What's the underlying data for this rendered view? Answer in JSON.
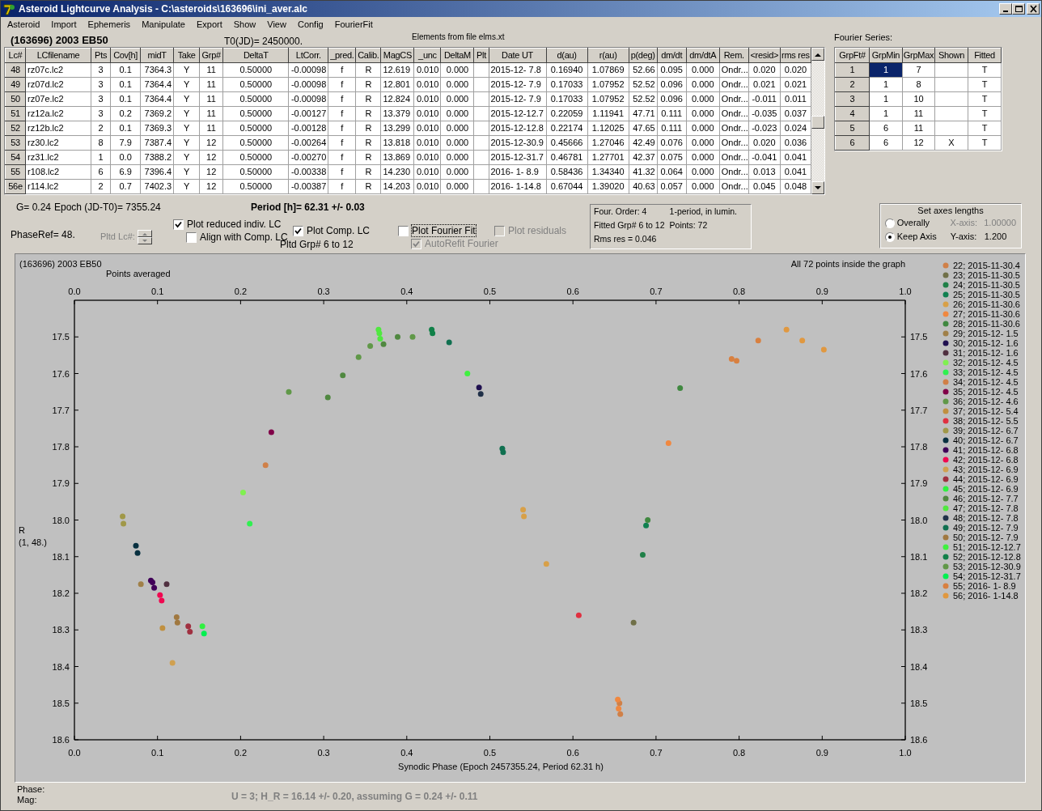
{
  "window": {
    "title": "Asteroid Lightcurve Analysis - C:\\asteroids\\163696\\ini_aver.alc"
  },
  "menu": [
    "Asteroid",
    "Import",
    "Ephemeris",
    "Manipulate",
    "Export",
    "Show",
    "View",
    "Config",
    "FourierFit"
  ],
  "header": {
    "object": "(163696) 2003 EB50",
    "t0": "T0(JD)= 2450000.",
    "elements": "Elements from file elms.xt"
  },
  "lc_table": {
    "columns": [
      "Lc#",
      "LCfilename",
      "Pts",
      "Cov[h]",
      "midT",
      "Take",
      "Grp#",
      "DeltaT",
      "LtCorr.",
      "_pred.",
      "Calib.",
      "MagCS",
      "_unc",
      "DeltaM",
      "Plt",
      "Date UT",
      "d(au)",
      "r(au)",
      "p(deg)",
      "dm/dt",
      "dm/dtA",
      "Rem.",
      "<resid>",
      "rms res"
    ],
    "rows": [
      {
        "cells": [
          "48",
          "rz07c.lc2",
          "3",
          "0.1",
          "7364.3",
          "Y",
          "11",
          "0.50000",
          "-0.00098",
          "f",
          "R",
          "12.619",
          "0.010",
          "0.000",
          null,
          "2015-12- 7.8",
          "0.16940",
          "1.07869",
          "52.66",
          "0.095",
          "0.000",
          "Ondr...",
          "0.020",
          "0.020"
        ]
      },
      {
        "cells": [
          "49",
          "rz07d.lc2",
          "3",
          "0.1",
          "7364.4",
          "Y",
          "11",
          "0.50000",
          "-0.00098",
          "f",
          "R",
          "12.801",
          "0.010",
          "0.000",
          null,
          "2015-12- 7.9",
          "0.17033",
          "1.07952",
          "52.52",
          "0.096",
          "0.000",
          "Ondr...",
          "0.021",
          "0.021"
        ]
      },
      {
        "cells": [
          "50",
          "rz07e.lc2",
          "3",
          "0.1",
          "7364.4",
          "Y",
          "11",
          "0.50000",
          "-0.00098",
          "f",
          "R",
          "12.824",
          "0.010",
          "0.000",
          null,
          "2015-12- 7.9",
          "0.17033",
          "1.07952",
          "52.52",
          "0.096",
          "0.000",
          "Ondr...",
          "-0.011",
          "0.011"
        ]
      },
      {
        "cells": [
          "51",
          "rz12a.lc2",
          "3",
          "0.2",
          "7369.2",
          "Y",
          "11",
          "0.50000",
          "-0.00127",
          "f",
          "R",
          "13.379",
          "0.010",
          "0.000",
          null,
          "2015-12-12.7",
          "0.22059",
          "1.11941",
          "47.71",
          "0.111",
          "0.000",
          "Ondr...",
          "-0.035",
          "0.037"
        ]
      },
      {
        "cells": [
          "52",
          "rz12b.lc2",
          "2",
          "0.1",
          "7369.3",
          "Y",
          "11",
          "0.50000",
          "-0.00128",
          "f",
          "R",
          "13.299",
          "0.010",
          "0.000",
          null,
          "2015-12-12.8",
          "0.22174",
          "1.12025",
          "47.65",
          "0.111",
          "0.000",
          "Ondr...",
          "-0.023",
          "0.024"
        ]
      },
      {
        "cells": [
          "53",
          "rz30.lc2",
          "8",
          "7.9",
          "7387.4",
          "Y",
          "12",
          "0.50000",
          "-0.00264",
          "f",
          "R",
          "13.818",
          "0.010",
          "0.000",
          null,
          "2015-12-30.9",
          "0.45666",
          "1.27046",
          "42.49",
          "0.076",
          "0.000",
          "Ondr...",
          "0.020",
          "0.036"
        ]
      },
      {
        "cells": [
          "54",
          "rz31.lc2",
          "1",
          "0.0",
          "7388.2",
          "Y",
          "12",
          "0.50000",
          "-0.00270",
          "f",
          "R",
          "13.869",
          "0.010",
          "0.000",
          null,
          "2015-12-31.7",
          "0.46781",
          "1.27701",
          "42.37",
          "0.075",
          "0.000",
          "Ondr...",
          "-0.041",
          "0.041"
        ]
      },
      {
        "cells": [
          "55",
          "r108.lc2",
          "6",
          "6.9",
          "7396.4",
          "Y",
          "12",
          "0.50000",
          "-0.00338",
          "f",
          "R",
          "14.230",
          "0.010",
          "0.000",
          null,
          "2016- 1- 8.9",
          "0.58436",
          "1.34340",
          "41.32",
          "0.064",
          "0.000",
          "Ondr...",
          "0.013",
          "0.041"
        ]
      },
      {
        "cells": [
          "56e",
          "r114.lc2",
          "2",
          "0.7",
          "7402.3",
          "Y",
          "12",
          "0.50000",
          "-0.00387",
          "f",
          "R",
          "14.203",
          "0.010",
          "0.000",
          null,
          "2016- 1-14.8",
          "0.67044",
          "1.39020",
          "40.63",
          "0.057",
          "0.000",
          "Ondr...",
          "0.045",
          "0.048"
        ]
      }
    ]
  },
  "fourier": {
    "title": "Fourier Series:",
    "columns": [
      "GrpFt#",
      "GrpMin",
      "GrpMax",
      "Shown",
      "Fitted"
    ],
    "rows": [
      {
        "cells": [
          "1",
          "1",
          "7",
          null,
          "T"
        ],
        "selected": true
      },
      {
        "cells": [
          "2",
          "1",
          "8",
          null,
          "T"
        ],
        "selected": false
      },
      {
        "cells": [
          "3",
          "1",
          "10",
          null,
          "T"
        ],
        "selected": false
      },
      {
        "cells": [
          "4",
          "1",
          "11",
          null,
          "T"
        ],
        "selected": false
      },
      {
        "cells": [
          "5",
          "6",
          "11",
          null,
          "T"
        ],
        "selected": false
      },
      {
        "cells": [
          "6",
          "6",
          "12",
          "X",
          "T"
        ],
        "selected": false
      }
    ]
  },
  "status": {
    "g": "G= 0.24",
    "epoch": "Epoch (JD-T0)= 7355.24",
    "period": "Period [h]= 62.31 +/- 0.03",
    "phase_ref": "PhaseRef= 48."
  },
  "pltd_lc": {
    "label": "Pltd Lc#:",
    "disabled": true
  },
  "option_groups": [
    {
      "options": [
        {
          "label": "Plot reduced indiv. LC",
          "checked": true,
          "disabled": false
        },
        {
          "label": "Align with Comp. LC",
          "checked": false,
          "disabled": false
        }
      ]
    },
    {
      "options": [
        {
          "label": "Plot Comp. LC",
          "checked": true,
          "disabled": false
        }
      ],
      "note": "Pltd Grp#  6  to  12"
    },
    {
      "options": [
        {
          "label": "Plot Fourier Fit",
          "checked": false,
          "disabled": false,
          "focused": true
        },
        {
          "label": "AutoRefit Fourier",
          "checked": true,
          "disabled": true
        }
      ]
    },
    {
      "options": [
        {
          "label": "Plot residuals",
          "checked": false,
          "disabled": true
        }
      ]
    }
  ],
  "fit_info": {
    "lines": [
      [
        "Four. Order:  4",
        "1-period, in lumin."
      ],
      [
        "Fitted Grp# 6 to 12",
        "Points: 72"
      ],
      [
        "Rms res     = 0.046"
      ]
    ]
  },
  "axes_box": {
    "title": "Set axes lengths",
    "options": [
      {
        "label": "Overally",
        "selected": false
      },
      {
        "label": "Keep Axis",
        "selected": true
      }
    ],
    "fields": [
      {
        "label": "X-axis:",
        "value": "1.00000",
        "disabled": true
      },
      {
        "label": "Y-axis:",
        "value": "1.200",
        "disabled": false
      }
    ]
  },
  "plot": {
    "title": "(163696) 2003 EB50",
    "subtitle": "Points averaged",
    "note": "All 72 points inside the graph",
    "y_note": "(1, 48.)",
    "chart_data": {
      "type": "scatter",
      "legend": "right",
      "xlabel": "Synodic Phase (Epoch 2457355.24, Period 62.31 h)",
      "ylabel": "R",
      "xlim": [
        0,
        1
      ],
      "ylim": [
        18.6,
        17.4
      ],
      "xticks": [
        {
          "value": 0,
          "label": "0.0"
        },
        {
          "value": 0.1,
          "label": "0.1"
        },
        {
          "value": 0.2,
          "label": "0.2"
        },
        {
          "value": 0.3,
          "label": "0.3"
        },
        {
          "value": 0.4,
          "label": "0.4"
        },
        {
          "value": 0.5,
          "label": "0.5"
        },
        {
          "value": 0.6,
          "label": "0.6"
        },
        {
          "value": 0.7,
          "label": "0.7"
        },
        {
          "value": 0.8,
          "label": "0.8"
        },
        {
          "value": 0.9,
          "label": "0.9"
        },
        {
          "value": 1,
          "label": "1.0"
        }
      ],
      "yticks": [
        {
          "value": 17.5,
          "label": "17.5"
        },
        {
          "value": 17.6,
          "label": "17.6"
        },
        {
          "value": 17.7,
          "label": "17.7"
        },
        {
          "value": 17.8,
          "label": "17.8"
        },
        {
          "value": 17.9,
          "label": "17.9"
        },
        {
          "value": 18,
          "label": "18.0"
        },
        {
          "value": 18.1,
          "label": "18.1"
        },
        {
          "value": 18.2,
          "label": "18.2"
        },
        {
          "value": 18.3,
          "label": "18.3"
        },
        {
          "value": 18.4,
          "label": "18.4"
        },
        {
          "value": 18.5,
          "label": "18.5"
        },
        {
          "value": 18.6,
          "label": "18.6"
        }
      ],
      "series": [
        {
          "name": "22; 2015-11-30.4",
          "color": "#d08048",
          "x": [
            0.656,
            0.657
          ],
          "values": [
            18.5,
            18.53
          ]
        },
        {
          "name": "23; 2015-11-30.5",
          "color": "#707048",
          "x": [
            0.673
          ],
          "values": [
            18.28
          ]
        },
        {
          "name": "24; 2015-11-30.5",
          "color": "#208048",
          "x": [
            0.684
          ],
          "values": [
            18.095
          ]
        },
        {
          "name": "25; 2015-11-30.5",
          "color": "#108050",
          "x": [
            0.688
          ],
          "values": [
            18.015
          ]
        },
        {
          "name": "26; 2015-11-30.6",
          "color": "#d8a048",
          "x": [
            0.54,
            0.541,
            0.568
          ],
          "values": [
            17.972,
            17.99,
            18.12
          ]
        },
        {
          "name": "27; 2015-11-30.6",
          "color": "#f08840",
          "x": [
            0.654,
            0.655,
            0.715
          ],
          "values": [
            18.49,
            18.515,
            17.79
          ]
        },
        {
          "name": "28; 2015-11-30.6",
          "color": "#408840",
          "x": [
            0.69,
            0.729
          ],
          "values": [
            18.0,
            17.64
          ]
        },
        {
          "name": "29; 2015-12- 1.5",
          "color": "#a08048",
          "x": [
            0.08
          ],
          "values": [
            18.175
          ]
        },
        {
          "name": "30; 2015-12- 1.6",
          "color": "#201050",
          "x": [
            0.487
          ],
          "values": [
            17.638
          ]
        },
        {
          "name": "31; 2015-12- 1.6",
          "color": "#503040",
          "x": [
            0.111
          ],
          "values": [
            18.175
          ]
        },
        {
          "name": "32; 2015-12- 4.5",
          "color": "#80f050",
          "x": [
            0.203
          ],
          "values": [
            17.925
          ]
        },
        {
          "name": "33; 2015-12- 4.5",
          "color": "#30f050",
          "x": [
            0.211
          ],
          "values": [
            18.01
          ]
        },
        {
          "name": "34; 2015-12- 4.5",
          "color": "#d08048",
          "x": [
            0.23
          ],
          "values": [
            17.85
          ]
        },
        {
          "name": "35; 2015-12- 4.5",
          "color": "#800048",
          "x": [
            0.237
          ],
          "values": [
            17.76
          ]
        },
        {
          "name": "36; 2015-12- 4.6",
          "color": "#609848",
          "x": [
            0.258,
            0.342,
            0.356
          ],
          "values": [
            17.65,
            17.555,
            17.525
          ]
        },
        {
          "name": "37; 2015-12- 5.4",
          "color": "#c09040",
          "x": [
            0.106
          ],
          "values": [
            18.295
          ]
        },
        {
          "name": "38; 2015-12- 5.5",
          "color": "#e03040",
          "x": [
            0.607
          ],
          "values": [
            18.26
          ]
        },
        {
          "name": "39; 2015-12- 6.7",
          "color": "#a09848",
          "x": [
            0.058,
            0.059
          ],
          "values": [
            17.99,
            18.01
          ]
        },
        {
          "name": "40; 2015-12- 6.7",
          "color": "#083040",
          "x": [
            0.074,
            0.076
          ],
          "values": [
            18.07,
            18.09
          ]
        },
        {
          "name": "41; 2015-12- 6.8",
          "color": "#400058",
          "x": [
            0.092,
            0.094,
            0.096
          ],
          "values": [
            18.165,
            18.17,
            18.185
          ]
        },
        {
          "name": "42; 2015-12- 6.8",
          "color": "#f00850",
          "x": [
            0.103,
            0.105
          ],
          "values": [
            18.205,
            18.22
          ]
        },
        {
          "name": "43; 2015-12- 6.9",
          "color": "#d0a050",
          "x": [
            0.118
          ],
          "values": [
            18.39
          ]
        },
        {
          "name": "44; 2015-12- 6.9",
          "color": "#a03040",
          "x": [
            0.137,
            0.139
          ],
          "values": [
            18.29,
            18.305
          ]
        },
        {
          "name": "45; 2015-12- 6.9",
          "color": "#30f040",
          "x": [
            0.154
          ],
          "values": [
            18.29
          ]
        },
        {
          "name": "46; 2015-12- 7.7",
          "color": "#508840",
          "x": [
            0.305,
            0.323,
            0.372,
            0.389
          ],
          "values": [
            17.665,
            17.605,
            17.52,
            17.5
          ]
        },
        {
          "name": "47; 2015-12- 7.8",
          "color": "#50e840",
          "x": [
            0.366,
            0.367,
            0.368
          ],
          "values": [
            17.48,
            17.49,
            17.505
          ]
        },
        {
          "name": "48; 2015-12- 7.8",
          "color": "#203048",
          "x": [
            0.489
          ],
          "values": [
            17.656
          ]
        },
        {
          "name": "49; 2015-12- 7.9",
          "color": "#107050",
          "x": [
            0.451,
            0.515,
            0.516
          ],
          "values": [
            17.515,
            17.805,
            17.815
          ]
        },
        {
          "name": "50; 2015-12- 7.9",
          "color": "#a07840",
          "x": [
            0.123,
            0.124
          ],
          "values": [
            18.265,
            18.28
          ]
        },
        {
          "name": "51; 2015-12-12.7",
          "color": "#40f040",
          "x": [
            0.473
          ],
          "values": [
            17.6
          ]
        },
        {
          "name": "52; 2015-12-12.8",
          "color": "#108048",
          "x": [
            0.43,
            0.431
          ],
          "values": [
            17.48,
            17.49
          ]
        },
        {
          "name": "53; 2015-12-30.9",
          "color": "#609848",
          "x": [
            0.407
          ],
          "values": [
            17.5
          ]
        },
        {
          "name": "54; 2015-12-31.7",
          "color": "#00f050",
          "x": [
            0.156
          ],
          "values": [
            18.31
          ]
        },
        {
          "name": "55; 2016- 1- 8.9",
          "color": "#d88040",
          "x": [
            0.791,
            0.797,
            0.823
          ],
          "values": [
            17.56,
            17.565,
            17.51
          ]
        },
        {
          "name": "56; 2016- 1-14.8",
          "color": "#e09840",
          "x": [
            0.857,
            0.876,
            0.902
          ],
          "values": [
            17.48,
            17.51,
            17.535
          ]
        }
      ]
    }
  },
  "footer": {
    "phase": "Phase:",
    "mag": "Mag:",
    "result": "U = 3; H_R = 16.14 +/- 0.20, assuming G = 0.24 +/- 0.11"
  }
}
